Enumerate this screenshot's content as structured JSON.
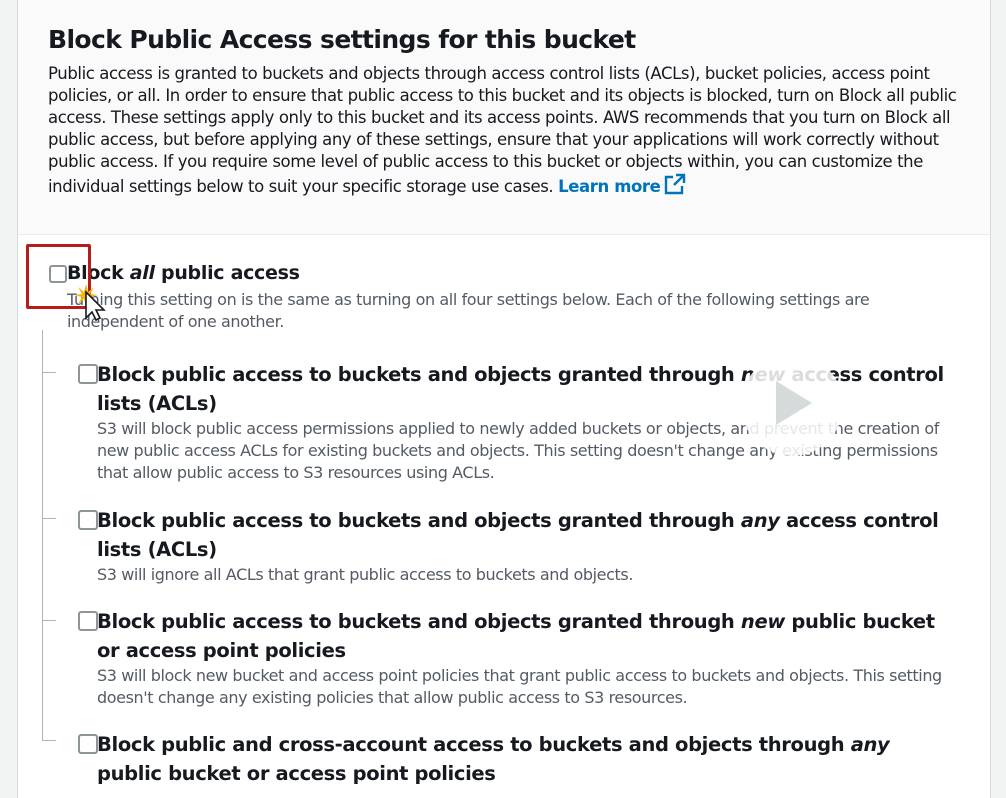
{
  "section": {
    "title": "Block Public Access settings for this bucket",
    "description": "Public access is granted to buckets and objects through access control lists (ACLs), bucket policies, access point policies, or all. In order to ensure that public access to this bucket and its objects is blocked, turn on Block all public access. These settings apply only to this bucket and its access points. AWS recommends that you turn on Block all public access, but before applying any of these settings, ensure that your applications will work correctly without public access. If you require some level of public access to this bucket or objects within, you can customize the individual settings below to suit your specific storage use cases.",
    "learn_more": "Learn more"
  },
  "block_all": {
    "label_pre": "Block ",
    "label_em": "all",
    "label_post": " public access",
    "description": "Turning this setting on is the same as turning on all four settings below. Each of the following settings are independent of one another.",
    "checked": false
  },
  "options": [
    {
      "label_pre": "Block public access to buckets and objects granted through ",
      "label_em": "new",
      "label_post": " access control lists (ACLs)",
      "description": "S3 will block public access permissions applied to newly added buckets or objects, and prevent the creation of new public access ACLs for existing buckets and objects. This setting doesn't change any existing permissions that allow public access to S3 resources using ACLs.",
      "checked": false
    },
    {
      "label_pre": "Block public access to buckets and objects granted through ",
      "label_em": "any",
      "label_post": " access control lists (ACLs)",
      "description": "S3 will ignore all ACLs that grant public access to buckets and objects.",
      "checked": false
    },
    {
      "label_pre": "Block public access to buckets and objects granted through ",
      "label_em": "new",
      "label_post": " public bucket or access point policies",
      "description": "S3 will block new bucket and access point policies that grant public access to buckets and objects. This setting doesn't change any existing policies that allow public access to S3 resources.",
      "checked": false
    },
    {
      "label_pre": "Block public and cross-account access to buckets and objects through ",
      "label_em": "any",
      "label_post": " public bucket or access point policies",
      "description": "",
      "checked": false
    }
  ],
  "icons": {
    "external_link": "external-link-icon",
    "cursor": "mouse-pointer-icon",
    "play": "play-icon"
  },
  "colors": {
    "link": "#0073bb",
    "highlight": "#b71c1c",
    "checkbox_border": "#8d9596"
  }
}
